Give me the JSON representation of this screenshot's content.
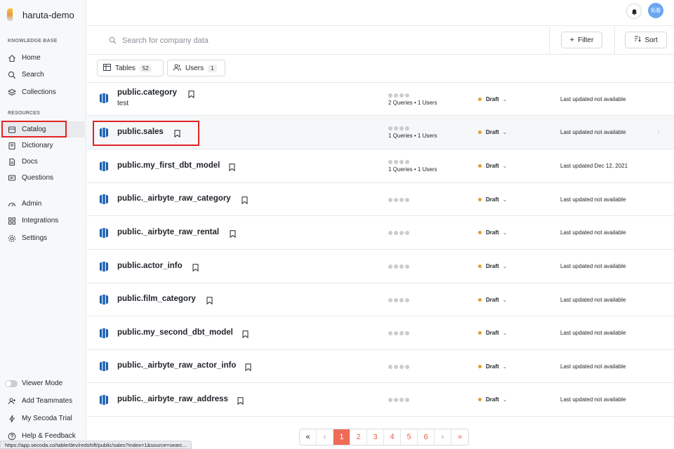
{
  "app": {
    "workspace_name": "haruta-demo",
    "avatar_text": "拓春"
  },
  "sidebar": {
    "knowledge_label": "KNOWLEDGE BASE",
    "resources_label": "RESOURCES",
    "knowledge_items": [
      {
        "label": "Home",
        "icon": "home-icon"
      },
      {
        "label": "Search",
        "icon": "search-icon"
      },
      {
        "label": "Collections",
        "icon": "collections-icon"
      }
    ],
    "resource_items": [
      {
        "label": "Catalog",
        "icon": "catalog-icon",
        "active": true
      },
      {
        "label": "Dictionary",
        "icon": "dictionary-icon"
      },
      {
        "label": "Docs",
        "icon": "docs-icon"
      },
      {
        "label": "Questions",
        "icon": "questions-icon"
      }
    ],
    "admin_items": [
      {
        "label": "Admin",
        "icon": "admin-icon"
      },
      {
        "label": "Integrations",
        "icon": "integrations-icon"
      },
      {
        "label": "Settings",
        "icon": "gear-icon"
      }
    ],
    "bottom_items": [
      {
        "label": "Viewer Mode",
        "icon": "toggle-icon"
      },
      {
        "label": "Add Teammates",
        "icon": "add-user-icon"
      },
      {
        "label": "My Secoda Trial",
        "icon": "bolt-icon"
      },
      {
        "label": "Help & Feedback",
        "icon": "help-icon"
      }
    ]
  },
  "search": {
    "placeholder": "Search for company data",
    "value": ""
  },
  "toolbar": {
    "filter_label": "Filter",
    "sort_label": "Sort"
  },
  "tabs": [
    {
      "label": "Tables",
      "count": "52"
    },
    {
      "label": "Users",
      "count": "1"
    }
  ],
  "status_color": "#e0a030",
  "rows": [
    {
      "name": "public.category",
      "description": "test",
      "queries": "2 Queries • 1 Users",
      "status": "Draft",
      "updated": "Last updated not available"
    },
    {
      "name": "public.sales",
      "description": "",
      "queries": "1 Queries • 1 Users",
      "status": "Draft",
      "updated": "Last updated not available"
    },
    {
      "name": "public.my_first_dbt_model",
      "description": "",
      "queries": "1 Queries • 1 Users",
      "status": "Draft",
      "updated": "Last updated Dec 12, 2021"
    },
    {
      "name": "public._airbyte_raw_category",
      "description": "",
      "queries": "",
      "status": "Draft",
      "updated": "Last updated not available"
    },
    {
      "name": "public._airbyte_raw_rental",
      "description": "",
      "queries": "",
      "status": "Draft",
      "updated": "Last updated not available"
    },
    {
      "name": "public.actor_info",
      "description": "",
      "queries": "",
      "status": "Draft",
      "updated": "Last updated not available"
    },
    {
      "name": "public.film_category",
      "description": "",
      "queries": "",
      "status": "Draft",
      "updated": "Last updated not available"
    },
    {
      "name": "public.my_second_dbt_model",
      "description": "",
      "queries": "",
      "status": "Draft",
      "updated": "Last updated not available"
    },
    {
      "name": "public._airbyte_raw_actor_info",
      "description": "",
      "queries": "",
      "status": "Draft",
      "updated": "Last updated not available"
    },
    {
      "name": "public._airbyte_raw_address",
      "description": "",
      "queries": "",
      "status": "Draft",
      "updated": "Last updated not available"
    }
  ],
  "pagination": {
    "first": "«",
    "prev": "‹",
    "pages": [
      "1",
      "2",
      "3",
      "4",
      "5",
      "6"
    ],
    "current": "1",
    "next": "›",
    "last": "»"
  },
  "status_url": "https://app.secoda.co/table/dev/redshift/public/sales?index=1&source=searc..."
}
